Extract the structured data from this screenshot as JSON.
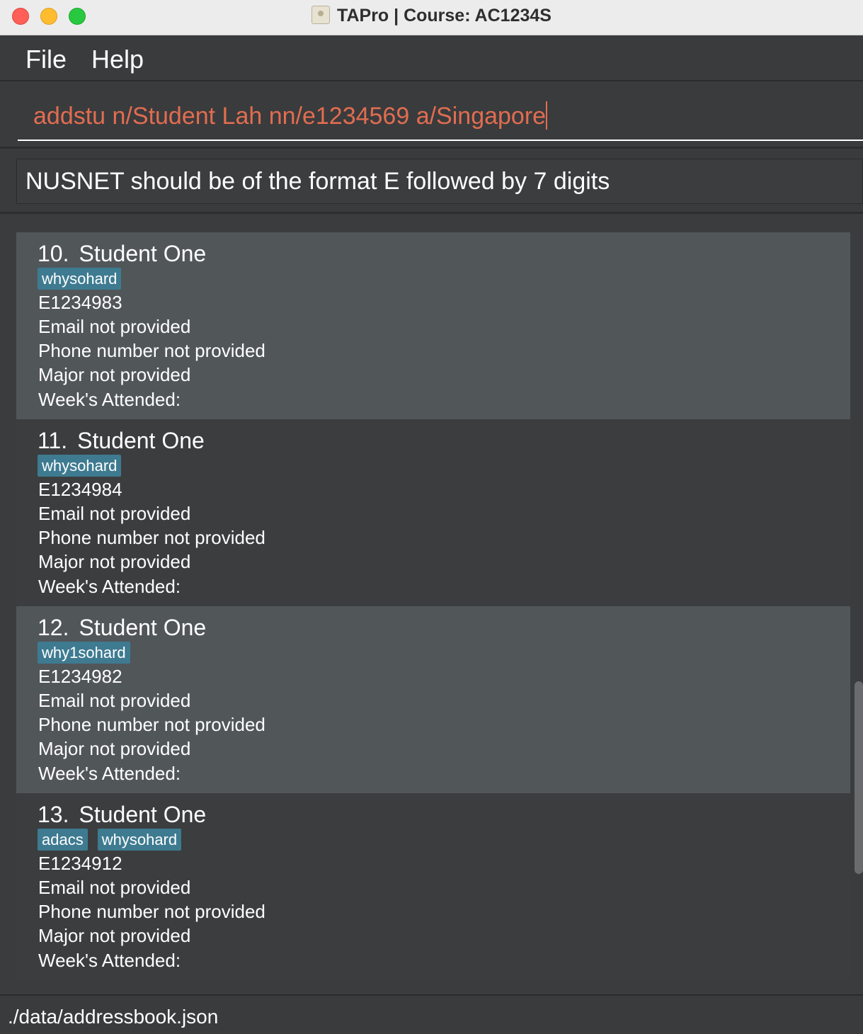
{
  "window": {
    "title": "TAPro | Course: AC1234S",
    "icon": "address-book-icon"
  },
  "menu": {
    "file": "File",
    "help": "Help"
  },
  "command": {
    "value": "addstu n/Student Lah nn/e1234569 a/Singapore",
    "color": "#e16d50"
  },
  "result": {
    "text": "NUSNET should be of the format E followed by 7 digits"
  },
  "students": [
    {
      "index": "10.",
      "name": "Student One",
      "tags": [
        "whysohard"
      ],
      "nusnet": "E1234983",
      "email": "Email not provided",
      "phone": "Phone number not provided",
      "major": "Major not provided",
      "weeks": "Week's Attended:"
    },
    {
      "index": "11.",
      "name": "Student One",
      "tags": [
        "whysohard"
      ],
      "nusnet": "E1234984",
      "email": "Email not provided",
      "phone": "Phone number not provided",
      "major": "Major not provided",
      "weeks": "Week's Attended:"
    },
    {
      "index": "12.",
      "name": "Student One",
      "tags": [
        "why1sohard"
      ],
      "nusnet": "E1234982",
      "email": "Email not provided",
      "phone": "Phone number not provided",
      "major": "Major not provided",
      "weeks": "Week's Attended:"
    },
    {
      "index": "13.",
      "name": "Student One",
      "tags": [
        "adacs",
        "whysohard"
      ],
      "nusnet": "E1234912",
      "email": "Email not provided",
      "phone": "Phone number not provided",
      "major": "Major not provided",
      "weeks": "Week's Attended:"
    }
  ],
  "status": {
    "path": "./data/addressbook.json"
  },
  "colors": {
    "tag": "#3e7b91",
    "card_light": "#515659",
    "card_dark": "#3c3d3f",
    "background": "#3b3c3e"
  }
}
